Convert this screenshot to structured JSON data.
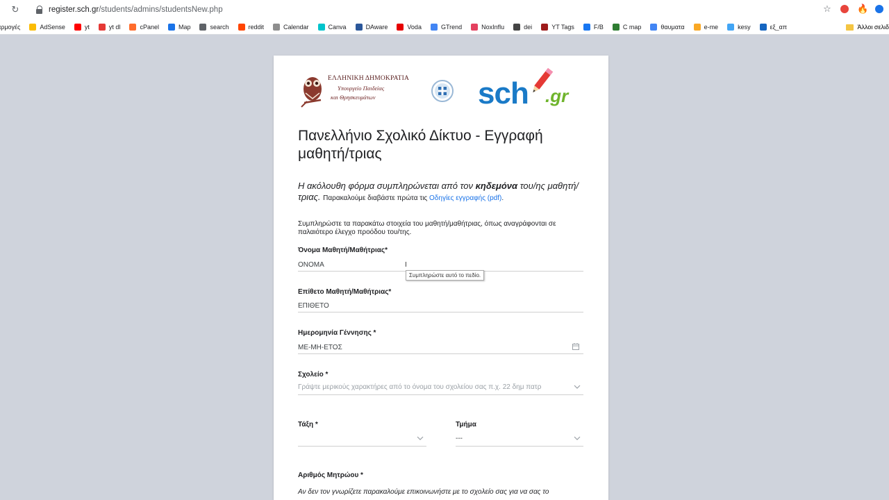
{
  "browser": {
    "url_host": "register.sch.gr",
    "url_path": "/students/admins/studentsNew.php"
  },
  "bookmarks": [
    {
      "label": "αρμογές",
      "color": "#6b9df0"
    },
    {
      "label": "AdSense",
      "color": "#fbbc04"
    },
    {
      "label": "yt",
      "color": "#ff0000"
    },
    {
      "label": "yt dl",
      "color": "#e53935"
    },
    {
      "label": "cPanel",
      "color": "#ff6c2c"
    },
    {
      "label": "Map",
      "color": "#1a73e8"
    },
    {
      "label": "search",
      "color": "#5f6368"
    },
    {
      "label": "reddit",
      "color": "#ff4500"
    },
    {
      "label": "Calendar",
      "color": "#8e8e8e"
    },
    {
      "label": "Canva",
      "color": "#00c4cc"
    },
    {
      "label": "DAware",
      "color": "#2b579a"
    },
    {
      "label": "Voda",
      "color": "#e60000"
    },
    {
      "label": "GTrend",
      "color": "#4285f4"
    },
    {
      "label": "NoxInflu",
      "color": "#e4405f"
    },
    {
      "label": "dei",
      "color": "#444444"
    },
    {
      "label": "YT Tags",
      "color": "#9e1b1b"
    },
    {
      "label": "F/B",
      "color": "#1877f2"
    },
    {
      "label": "C map",
      "color": "#2e7d32"
    },
    {
      "label": "θαυματα",
      "color": "#4285f4"
    },
    {
      "label": "e-me",
      "color": "#f9a825"
    },
    {
      "label": "kesy",
      "color": "#42a5f5"
    },
    {
      "label": "εξ_απ",
      "color": "#1565c0"
    }
  ],
  "bookmarks_other": "Άλλοι σελιδ",
  "ministry": {
    "line1": "ΕΛΛΗΝΙΚΗ ΔΗΜΟΚΡΑΤΙΑ",
    "line2": "Υπουργείο Παιδείας",
    "line3": "και Θρησκευμάτων"
  },
  "sch_logo": {
    "main": "sch",
    "suffix": ".gr"
  },
  "form": {
    "title": "Πανελλήνιο Σχολικό Δίκτυο - Εγγραφή μαθητή/τριας",
    "intro_a": "Η ακόλουθη φόρμα συμπληρώνεται από τον ",
    "intro_bold": "κηδεμόνα",
    "intro_b": " του/ης μαθητή/τριας. ",
    "intro_small": "Παρακαλούμε διαβάστε πρώτα τις ",
    "intro_link": "Οδηγίες εγγραφής (pdf)",
    "intro_end": ".",
    "description": "Συμπληρώστε τα παρακάτω στοιχεία του μαθητή/μαθήτριας, όπως αναγράφονται σε παλαιότερο έλεγχο προόδου του/της.",
    "first_name": {
      "label": "Όνομα Μαθητή/Μαθήτριας*",
      "placeholder": "ΟΝΟΜΑ"
    },
    "last_name": {
      "label": "Επίθετο Μαθητή/Μαθήτριας*",
      "placeholder": "ΕΠΙΘΕΤΟ"
    },
    "birth_date": {
      "label": "Ημερομηνία Γέννησης *",
      "placeholder": "ΜΕ-ΜΗ-ΕΤΟΣ"
    },
    "school": {
      "label": "Σχολείο *",
      "placeholder": "Γράψτε μερικούς χαρακτήρες από το όνομα του σχολείου σας π.χ. 22 δημ πατρ"
    },
    "grade": {
      "label": "Τάξη *",
      "value": ""
    },
    "section": {
      "label": "Τμήμα",
      "value": "---"
    },
    "registry_number": {
      "label": "Αριθμός Μητρώου *"
    },
    "footnote": "Αν δεν τον γνωρίζετε παρακαλούμε επικοινωνήστε με το σχολείο σας για να σας το"
  },
  "tooltip": "Συμπληρώστε αυτό το πεδίο."
}
